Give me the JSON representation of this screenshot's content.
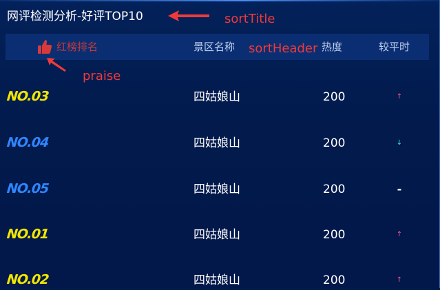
{
  "panel": {
    "title": "网评检测分析-好评TOP10"
  },
  "header": {
    "praise_label": "红榜排名",
    "name_label": "景区名称",
    "heat_label": "热度",
    "compare_label": "较平时"
  },
  "annotations": {
    "sort_title": "sortTitle",
    "sort_header": "sortHeader",
    "praise": "praise"
  },
  "rows": [
    {
      "rank": "NO.03",
      "name": "四姑娘山",
      "heat": "200",
      "trend": "up",
      "trend_symbol": "↑"
    },
    {
      "rank": "NO.04",
      "name": "四姑娘山",
      "heat": "200",
      "trend": "down",
      "trend_symbol": "↓"
    },
    {
      "rank": "NO.05",
      "name": "四姑娘山",
      "heat": "200",
      "trend": "flat",
      "trend_symbol": "-"
    },
    {
      "rank": "NO.01",
      "name": "四姑娘山",
      "heat": "200",
      "trend": "up",
      "trend_symbol": "↑"
    },
    {
      "rank": "NO.02",
      "name": "四姑娘山",
      "heat": "200",
      "trend": "up",
      "trend_symbol": "↑"
    }
  ],
  "colors": {
    "rank_gold": "#f2e600",
    "rank_blue": "#2f86ff",
    "trend_up": "#ff5e86",
    "trend_down": "#36e6d6",
    "annotation": "#f03a3a",
    "header_bar": "#0b2e72",
    "background": "#021a4a"
  },
  "icons": {
    "praise": "thumbs-up-icon"
  }
}
